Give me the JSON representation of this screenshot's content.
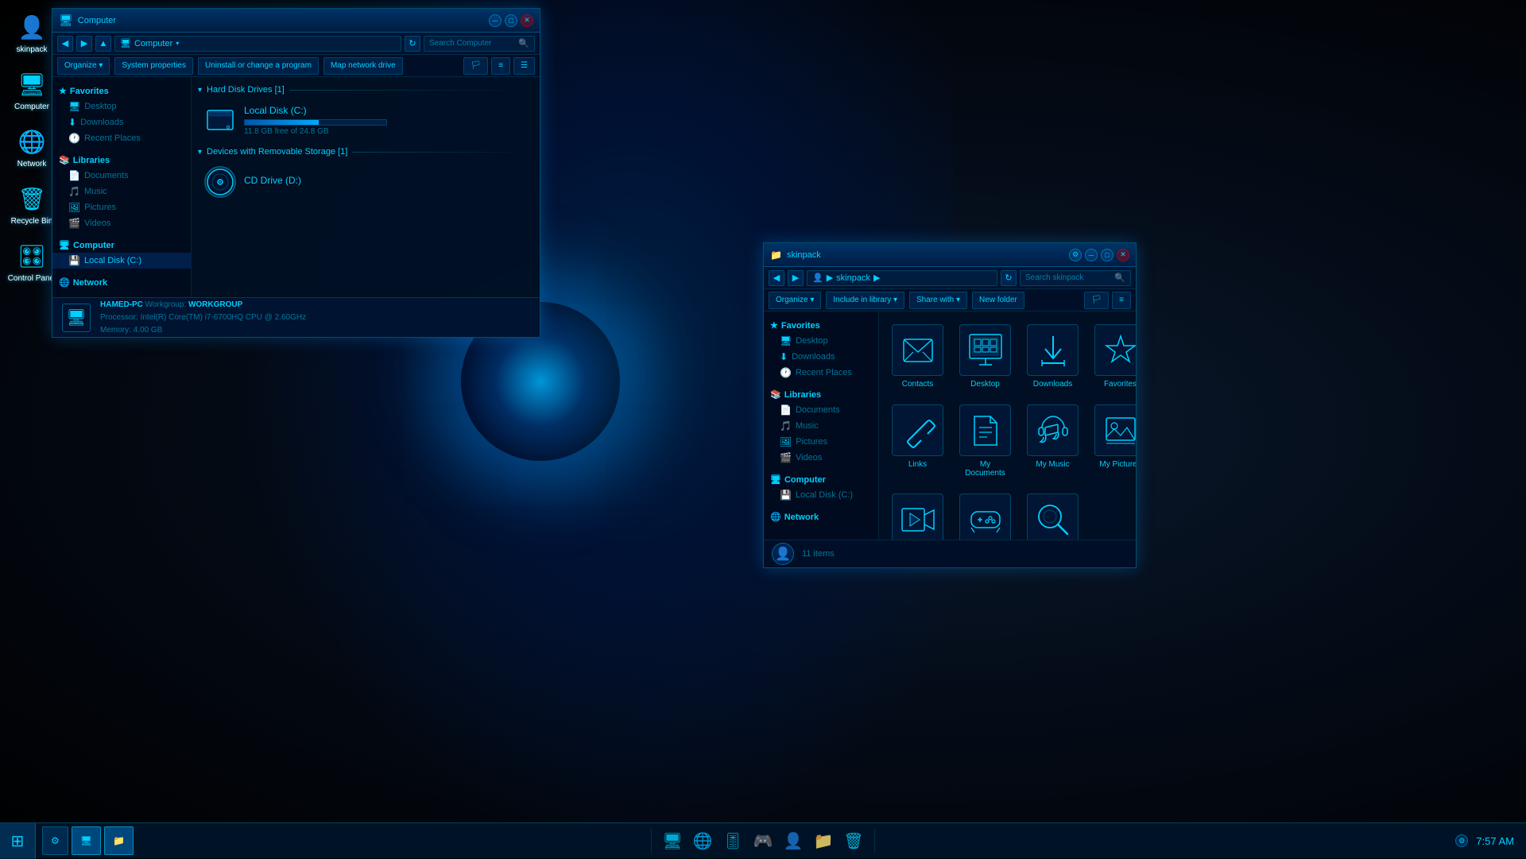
{
  "desktop": {
    "icons": [
      {
        "id": "skinpack",
        "label": "skinpack",
        "icon": "👤"
      },
      {
        "id": "computer",
        "label": "Computer",
        "icon": "🖥"
      },
      {
        "id": "network",
        "label": "Network",
        "icon": "🌐"
      },
      {
        "id": "recycle",
        "label": "Recycle Bin",
        "icon": "🗑"
      },
      {
        "id": "control",
        "label": "Control Panel",
        "icon": "🎛"
      }
    ]
  },
  "window1": {
    "title": "Computer",
    "nav_path": "Computer",
    "search_placeholder": "Search Computer",
    "toolbar": {
      "organize": "Organize ▾",
      "system_props": "System properties",
      "uninstall": "Uninstall or change a program",
      "map_drive": "Map network drive"
    },
    "sidebar": {
      "favorites_label": "Favorites",
      "favorites_items": [
        "Desktop",
        "Downloads",
        "Recent Places"
      ],
      "libraries_label": "Libraries",
      "libraries_items": [
        "Documents",
        "Music",
        "Pictures",
        "Videos"
      ],
      "computer_label": "Computer",
      "computer_items": [
        "Local Disk (C:)"
      ],
      "network_label": "Network"
    },
    "content": {
      "hdd_section": "Hard Disk Drives [1]",
      "local_disk": "Local Disk (C:)",
      "disk_free": "11.8 GB free of 24.8 GB",
      "disk_used_pct": 52,
      "removable_section": "Devices with Removable Storage [1]",
      "cd_drive": "CD Drive (D:)"
    },
    "sysinfo": {
      "name": "HAMED-PC",
      "workgroup_label": "Workgroup:",
      "workgroup": "WORKGROUP",
      "processor_label": "Processor:",
      "processor": "Intel(R) Core(TM) i7-6700HQ CPU @ 2.60GHz",
      "memory_label": "Memory:",
      "memory": "4.00 GB"
    }
  },
  "window2": {
    "title": "skinpack",
    "nav_path_parts": [
      "skinpack"
    ],
    "search_placeholder": "Search skinpack",
    "toolbar": {
      "organize": "Organize ▾",
      "include_library": "Include in library ▾",
      "share_with": "Share with ▾",
      "new_folder": "New folder"
    },
    "sidebar": {
      "favorites_label": "Favorites",
      "favorites_items": [
        "Desktop",
        "Downloads",
        "Recent Places"
      ],
      "libraries_label": "Libraries",
      "libraries_items": [
        "Documents",
        "Music",
        "Pictures",
        "Videos"
      ],
      "computer_label": "Computer",
      "computer_items": [
        "Local Disk (C:)"
      ],
      "network_label": "Network"
    },
    "grid_items": [
      {
        "id": "contacts",
        "label": "Contacts",
        "icon_type": "envelope"
      },
      {
        "id": "desktop",
        "label": "Desktop",
        "icon_type": "grid"
      },
      {
        "id": "downloads",
        "label": "Downloads",
        "icon_type": "download"
      },
      {
        "id": "favorites",
        "label": "Favorites",
        "icon_type": "star"
      },
      {
        "id": "links",
        "label": "Links",
        "icon_type": "link"
      },
      {
        "id": "my-documents",
        "label": "My Documents",
        "icon_type": "document"
      },
      {
        "id": "my-music",
        "label": "My Music",
        "icon_type": "headphones"
      },
      {
        "id": "my-pictures",
        "label": "My Pictures",
        "icon_type": "picture"
      },
      {
        "id": "my-videos",
        "label": "My Videos",
        "icon_type": "video"
      },
      {
        "id": "saved-games",
        "label": "Saved Games",
        "icon_type": "gamepad"
      },
      {
        "id": "searches",
        "label": "Searches",
        "icon_type": "search"
      }
    ],
    "status": {
      "items_count": "11 items"
    }
  },
  "taskbar": {
    "time": "7:57 AM",
    "items": [
      {
        "id": "connections",
        "label": "Connections",
        "icon": "⚙"
      },
      {
        "id": "explorer1",
        "label": "Computer",
        "icon": "🖥"
      },
      {
        "id": "explorer2",
        "label": "skinpack",
        "icon": "📁"
      }
    ],
    "dock_icons": [
      "🖥",
      "🌐",
      "🎮",
      "🎯",
      "👤",
      "📁",
      "🗑"
    ]
  },
  "colors": {
    "accent": "#00cfff",
    "bg_dark": "#000d1a",
    "window_bg": "rgba(0,15,35,0.97)"
  }
}
